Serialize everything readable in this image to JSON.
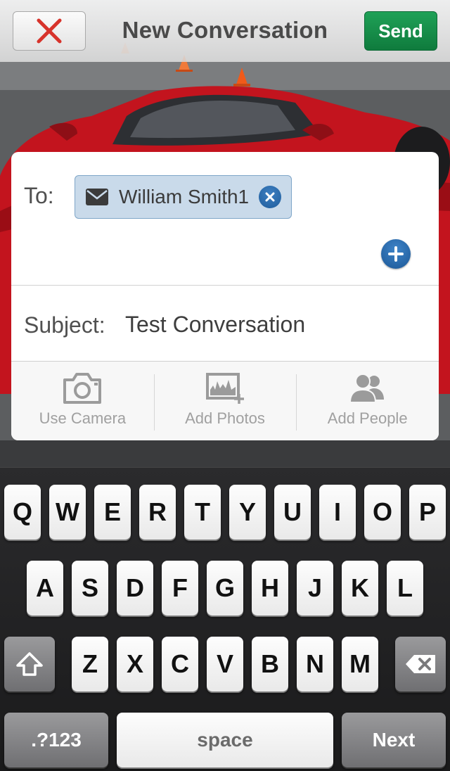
{
  "navbar": {
    "title": "New Conversation",
    "send_label": "Send",
    "close_icon": "close-x-icon",
    "colors": {
      "close_x": "#d7332b",
      "send_bg": "#128a45"
    }
  },
  "compose": {
    "to_label": "To:",
    "recipients": [
      {
        "name": "William Smith1",
        "type_icon": "envelope-icon",
        "remove_icon": "remove-circle-icon"
      }
    ],
    "add_recipient_icon": "add-circle-icon",
    "subject_label": "Subject:",
    "subject_value": "Test Conversation",
    "actions": [
      {
        "label": "Use Camera",
        "icon": "camera-icon"
      },
      {
        "label": "Add Photos",
        "icon": "add-photos-icon"
      },
      {
        "label": "Add People",
        "icon": "people-icon"
      }
    ]
  },
  "keyboard": {
    "row1": [
      "Q",
      "W",
      "E",
      "R",
      "T",
      "Y",
      "U",
      "I",
      "O",
      "P"
    ],
    "row2": [
      "A",
      "S",
      "D",
      "F",
      "G",
      "H",
      "J",
      "K",
      "L"
    ],
    "row3": [
      "Z",
      "X",
      "C",
      "V",
      "B",
      "N",
      "M"
    ],
    "shift_icon": "shift-arrow-icon",
    "backspace_icon": "backspace-icon",
    "numbers_label": ".?123",
    "space_label": "space",
    "next_label": "Next"
  }
}
